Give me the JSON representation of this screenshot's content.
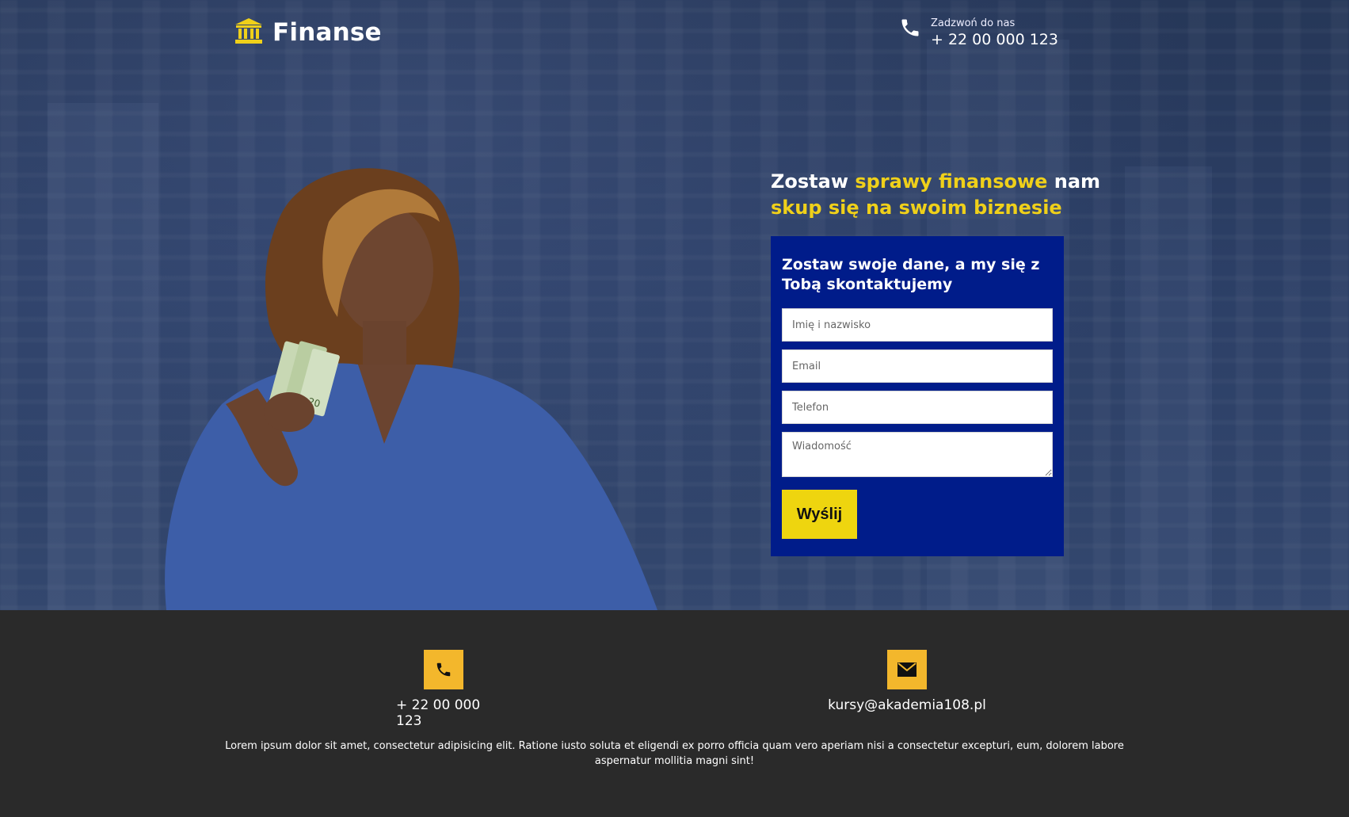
{
  "header": {
    "brand": "Finanse",
    "call_label": "Zadzwoń do nas",
    "call_phone": "+ 22 00 000 123"
  },
  "hero": {
    "headline_part1": "Zostaw ",
    "headline_accent1": "sprawy finansowe",
    "headline_part2": " nam",
    "headline_line2": "skup się na swoim biznesie"
  },
  "form": {
    "title": "Zostaw swoje dane, a my się z Tobą skontaktujemy",
    "name_placeholder": "Imię i nazwisko",
    "email_placeholder": "Email",
    "phone_placeholder": "Telefon",
    "message_placeholder": "Wiadomość",
    "submit_label": "Wyślij"
  },
  "footer": {
    "phone": "+ 22 00 000 123",
    "email": "kursy@akademia108.pl",
    "lorem": "Lorem ipsum dolor sit amet, consectetur adipisicing elit. Ratione iusto soluta et eligendi ex porro officia quam vero aperiam nisi a consectetur excepturi, eum, dolorem labore aspernatur mollitia magni sint!"
  },
  "colors": {
    "accent_yellow": "#efd01a",
    "form_blue": "#001c8a",
    "footer_bg": "#2a2a2a",
    "icon_badge": "#f3b72c"
  },
  "icons": [
    "bank-icon",
    "phone-icon",
    "envelope-icon"
  ]
}
